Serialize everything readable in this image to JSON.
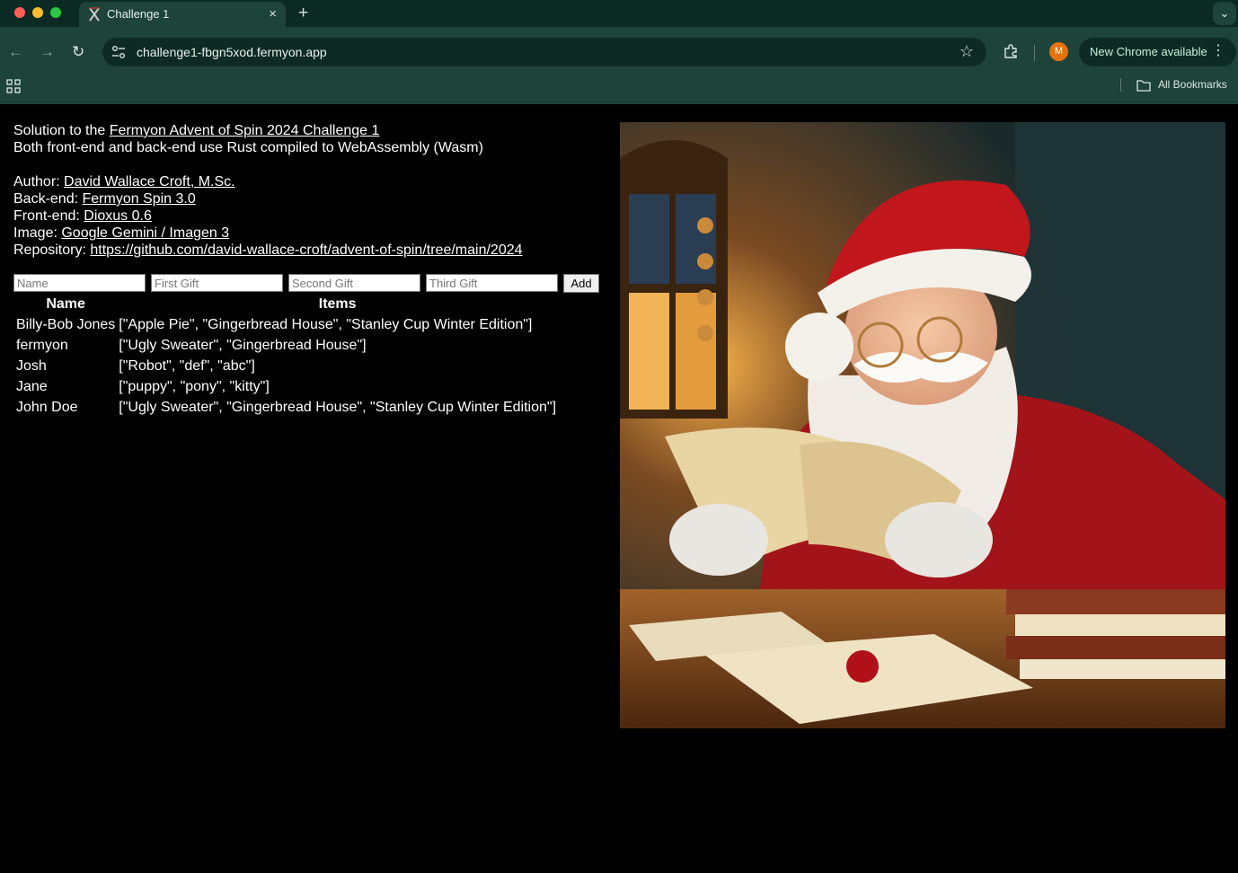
{
  "browser": {
    "tab_title": "Challenge 1",
    "tab_close": "×",
    "new_tab": "+",
    "tab_menu": "⌄",
    "url": "challenge1-fbgn5xod.fermyon.app",
    "back_glyph": "←",
    "forward_glyph": "→",
    "reload_glyph": "↻",
    "bookmark_star": "☆",
    "profile_initial": "M",
    "update_label": "New Chrome available",
    "menu_glyph": "⋮",
    "bookmarks_label": "All Bookmarks"
  },
  "page": {
    "intro_line1_prefix": "Solution to the ",
    "intro_line1_link": "Fermyon Advent of Spin 2024 Challenge 1",
    "intro_line2": "Both front-end and back-end use Rust compiled to WebAssembly (Wasm)",
    "author_label": "Author: ",
    "author_link": "David Wallace Croft, M.Sc.",
    "backend_label": "Back-end: ",
    "backend_link": "Fermyon Spin 3.0",
    "frontend_label": "Front-end: ",
    "frontend_link": "Dioxus 0.6",
    "image_label": "Image: ",
    "image_link": "Google Gemini / Imagen 3",
    "repo_label": "Repository: ",
    "repo_link": "https://github.com/david-wallace-croft/advent-of-spin/tree/main/2024"
  },
  "form": {
    "name_placeholder": "Name",
    "gift1_placeholder": "First Gift",
    "gift2_placeholder": "Second Gift",
    "gift3_placeholder": "Third Gift",
    "add_label": "Add"
  },
  "table": {
    "headers": [
      "Name",
      "Items"
    ],
    "rows": [
      {
        "name": "Billy-Bob Jones",
        "items": "[\"Apple Pie\", \"Gingerbread House\", \"Stanley Cup Winter Edition\"]"
      },
      {
        "name": "fermyon",
        "items": "[\"Ugly Sweater\", \"Gingerbread House\"]"
      },
      {
        "name": "Josh",
        "items": "[\"Robot\", \"def\", \"abc\"]"
      },
      {
        "name": "Jane",
        "items": "[\"puppy\", \"pony\", \"kitty\"]"
      },
      {
        "name": "John Doe",
        "items": "[\"Ugly Sweater\", \"Gingerbread House\", \"Stanley Cup Winter Edition\"]"
      }
    ]
  },
  "colors": {
    "chrome_frame": "#0c2a24",
    "chrome_toolbar": "#1d433b",
    "page_background": "#000000",
    "text": "#ffffff",
    "avatar": "#e8710a"
  },
  "icons": {
    "tab_favicon": "spin-favicon-icon",
    "site_info": "tune-icon",
    "extensions": "puzzle-icon",
    "apps": "apps-grid-icon",
    "bookmarks_folder": "folder-icon",
    "hero": "santa-reading-letter-illustration"
  }
}
